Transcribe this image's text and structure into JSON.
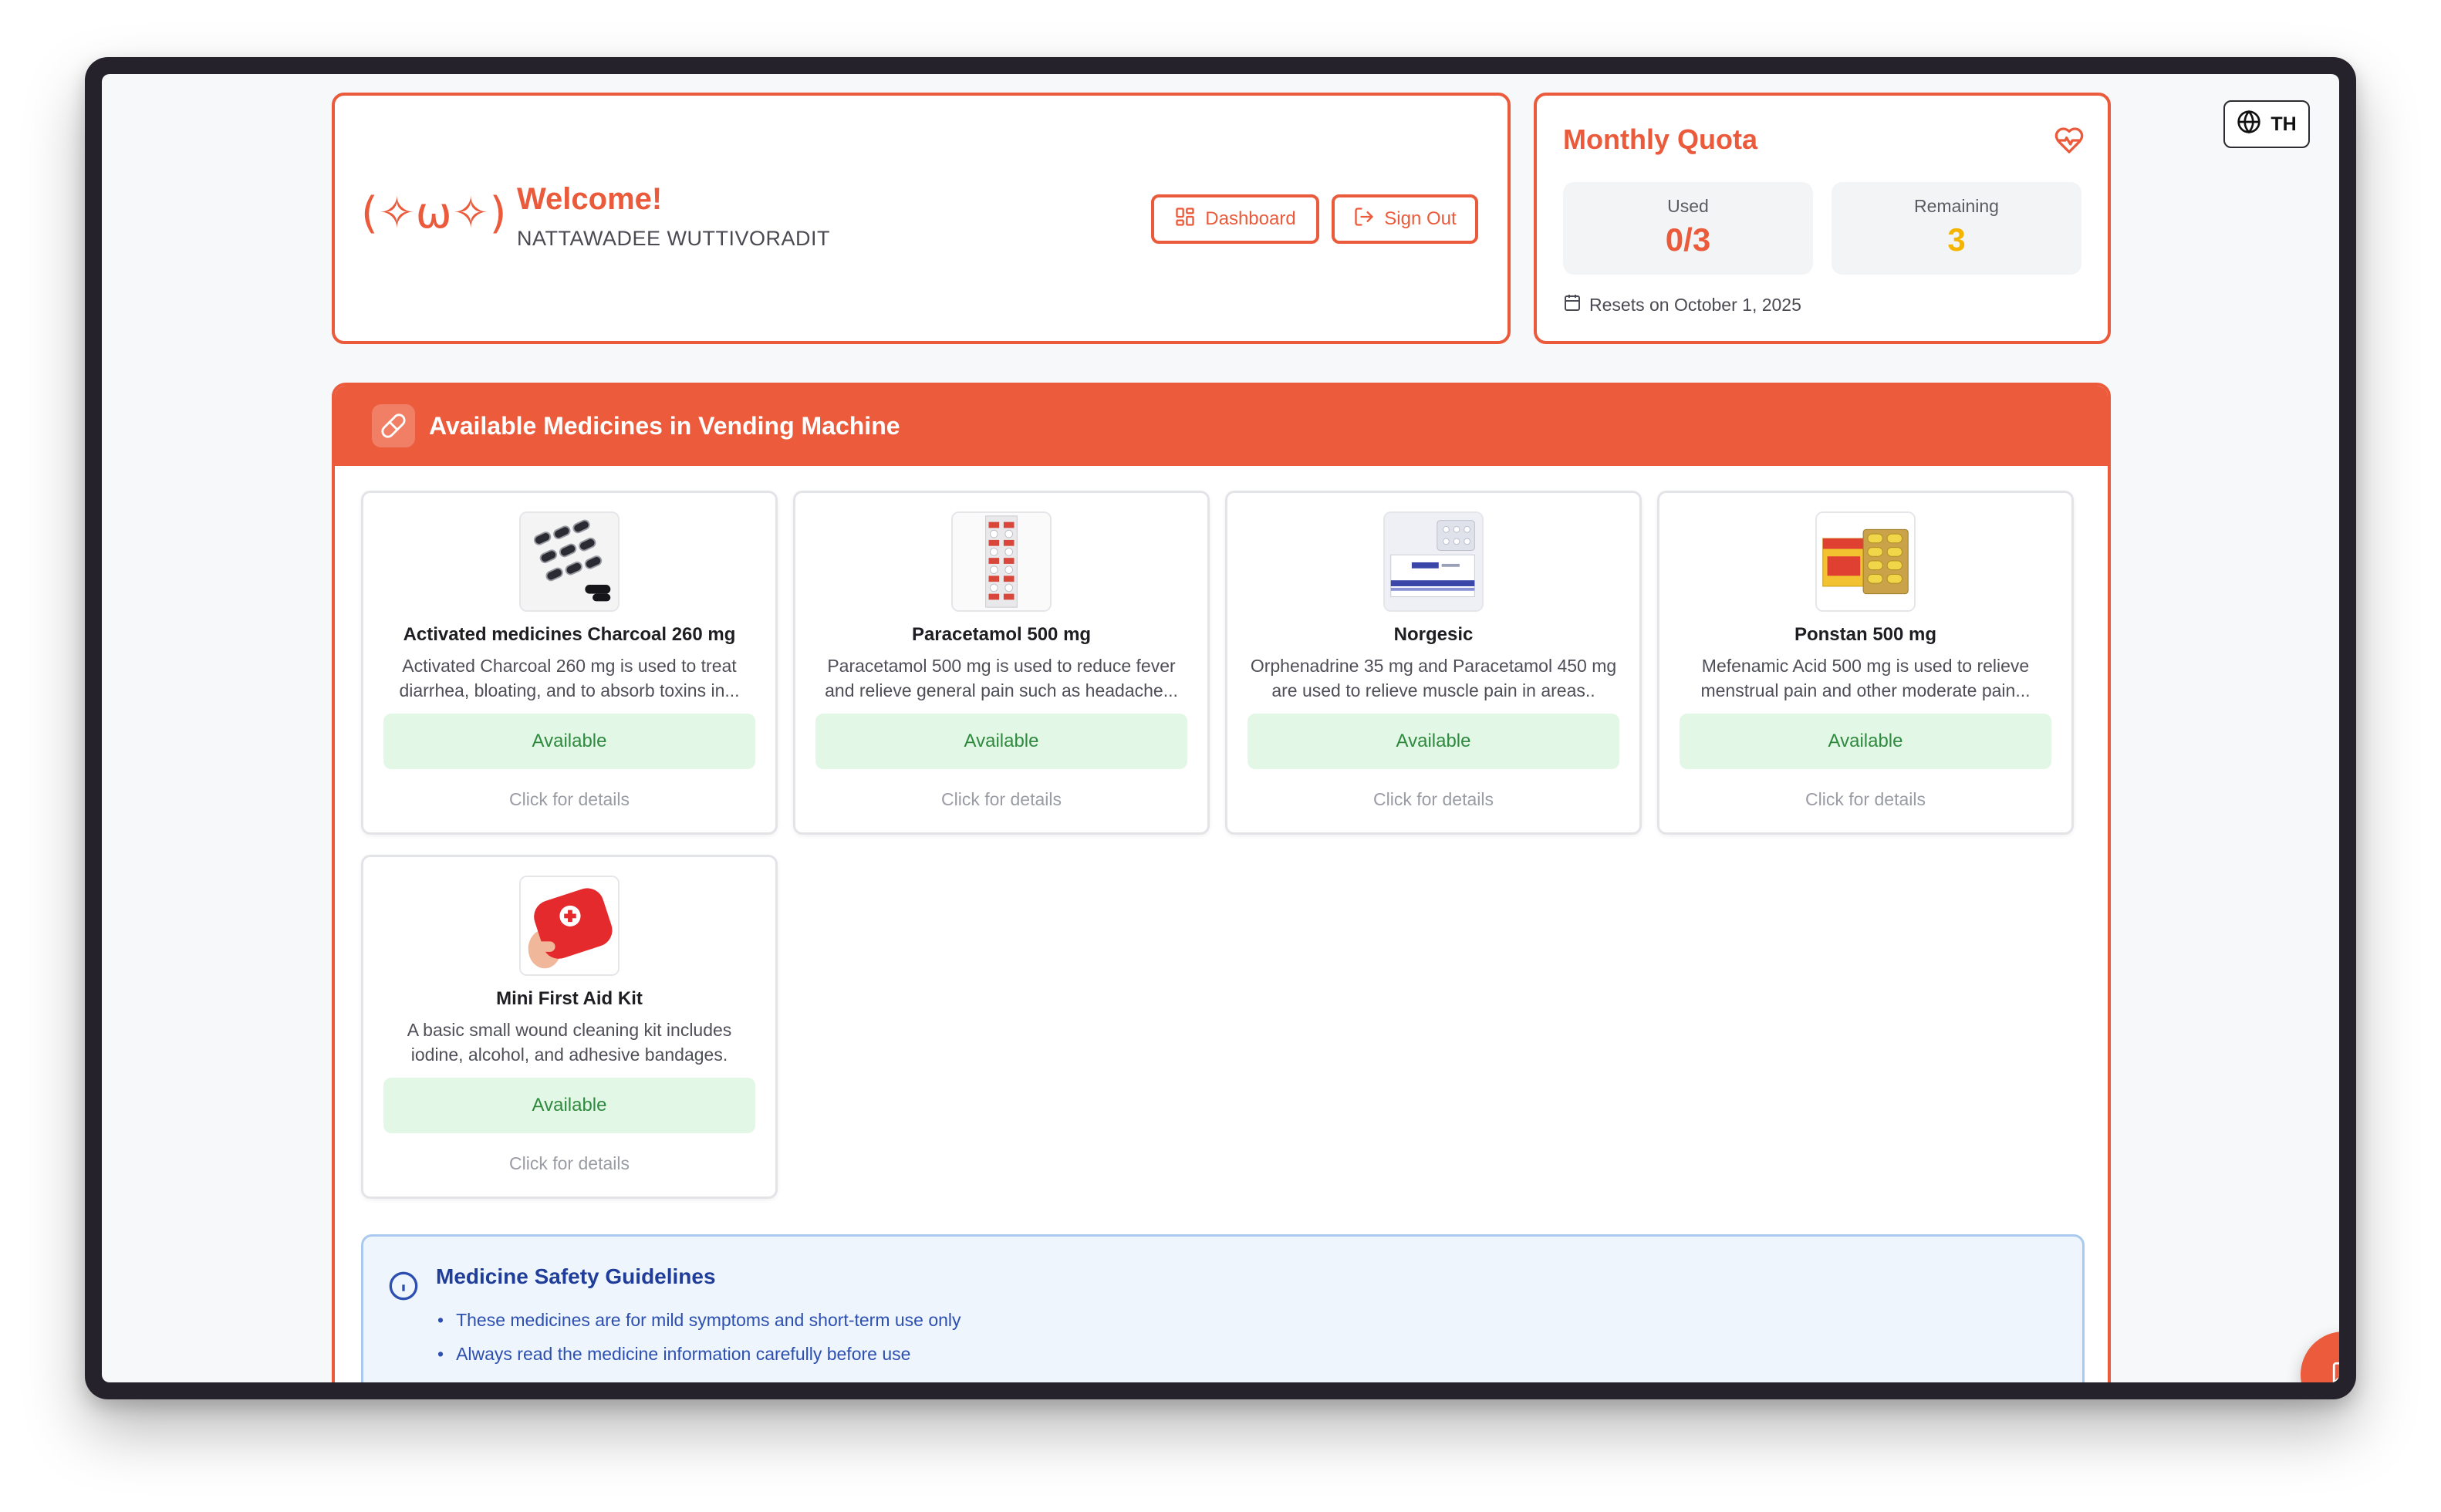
{
  "welcome": {
    "kaomoji": "(✧ω✧)",
    "title": "Welcome!",
    "user_name": "NATTAWADEE WUTTIVORADIT",
    "dashboard_label": "Dashboard",
    "signout_label": "Sign Out"
  },
  "quota": {
    "title": "Monthly Quota",
    "used_label": "Used",
    "used_value": "0/3",
    "remaining_label": "Remaining",
    "remaining_value": "3",
    "resets_text": "Resets on October 1, 2025"
  },
  "language": {
    "label": "TH"
  },
  "medicines": {
    "header": "Available Medicines in Vending Machine",
    "items": [
      {
        "name": "Activated medicines Charcoal 260 mg",
        "description": "Activated Charcoal 260 mg is used to treat diarrhea, bloating, and to absorb toxins in...",
        "status": "Available",
        "hint": "Click for details"
      },
      {
        "name": "Paracetamol 500 mg",
        "description": "Paracetamol 500 mg is used to reduce fever and relieve general pain such as headache...",
        "status": "Available",
        "hint": "Click for details"
      },
      {
        "name": "Norgesic",
        "description": "Orphenadrine 35 mg and Paracetamol 450 mg are used to relieve muscle pain in areas..",
        "status": "Available",
        "hint": "Click for details"
      },
      {
        "name": "Ponstan 500 mg",
        "description": "Mefenamic Acid 500 mg is used to relieve menstrual pain and other moderate pain...",
        "status": "Available",
        "hint": "Click for details"
      },
      {
        "name": "Mini First Aid Kit",
        "description": "A basic small wound cleaning kit includes iodine, alcohol, and adhesive bandages.",
        "status": "Available",
        "hint": "Click for details"
      }
    ]
  },
  "guidelines": {
    "title": "Medicine Safety Guidelines",
    "items": [
      "These medicines are for mild symptoms and short-term use only",
      "Always read the medicine information carefully before use"
    ]
  },
  "colors": {
    "accent": "#ea5a3b",
    "available_bg": "#e2f7e6",
    "available_text": "#2f8a3f",
    "remaining": "#f4b400"
  },
  "icons": {
    "dashboard": "grid-icon",
    "signout": "sign-out-icon",
    "quota": "heart-pulse-icon",
    "resets": "calendar-icon",
    "language": "globe-icon",
    "header": "pill-icon",
    "guidelines": "info-icon",
    "chat": "chat-icon"
  }
}
